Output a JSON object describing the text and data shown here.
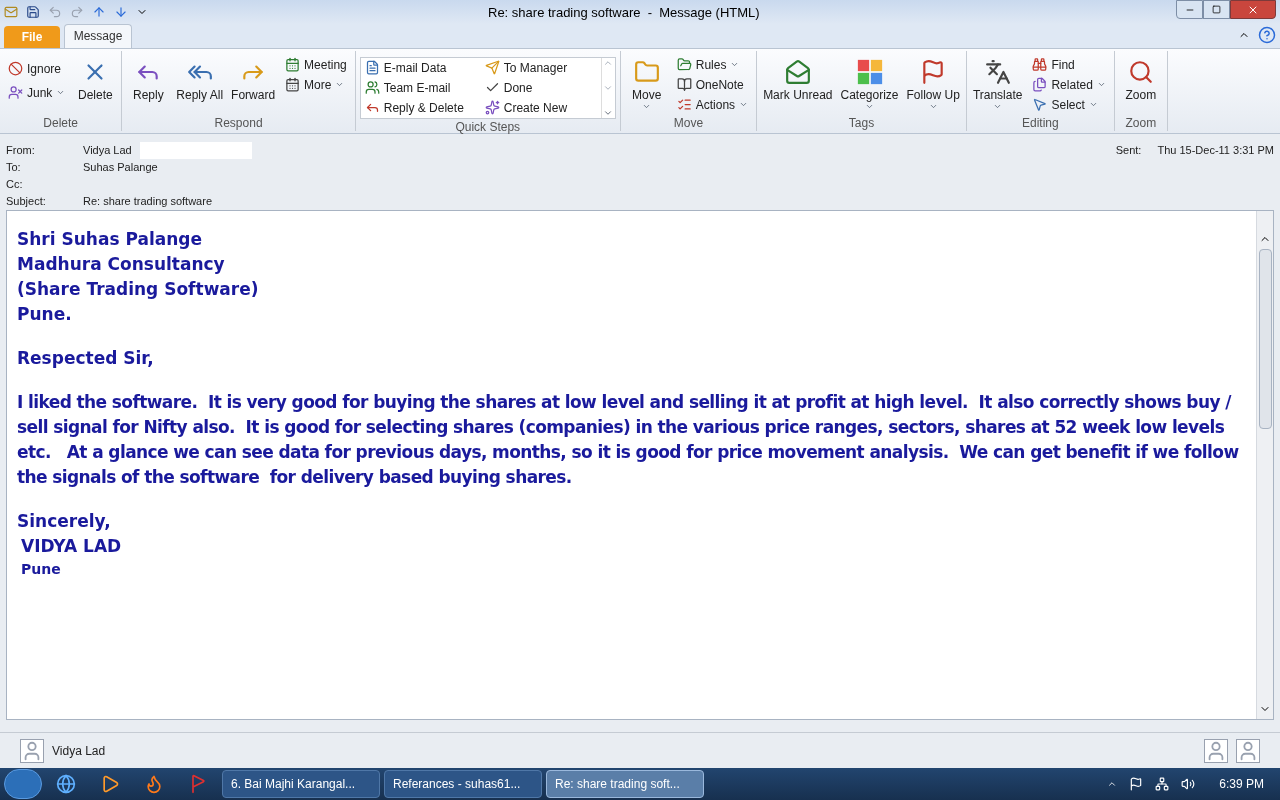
{
  "window": {
    "title": "Re: share trading software  -  Message (HTML)"
  },
  "ribbon": {
    "tabs": [
      {
        "label": "File",
        "kind": "file",
        "selected": false
      },
      {
        "label": "Message",
        "kind": "tab",
        "selected": true
      }
    ],
    "groups": [
      {
        "label": "Delete",
        "buttons": [
          {
            "label": "Ignore",
            "kind": "small",
            "dropdown": false
          },
          {
            "label": "Junk",
            "kind": "small",
            "dropdown": true
          },
          {
            "label": "Delete",
            "kind": "large",
            "dropdown": false
          }
        ]
      },
      {
        "label": "Respond",
        "buttons": [
          {
            "label": "Reply",
            "kind": "large",
            "dropdown": false
          },
          {
            "label": "Reply All",
            "kind": "large",
            "dropdown": false
          },
          {
            "label": "Forward",
            "kind": "large",
            "dropdown": false
          },
          {
            "label": "Meeting",
            "kind": "small",
            "dropdown": false
          },
          {
            "label": "More",
            "kind": "small",
            "dropdown": true
          }
        ]
      },
      {
        "label": "Quick Steps",
        "buttons": [
          {
            "label": "E-mail Data",
            "kind": "quick",
            "dropdown": false
          },
          {
            "label": "To Manager",
            "kind": "quick",
            "dropdown": false
          },
          {
            "label": "Team E-mail",
            "kind": "quick",
            "dropdown": false
          },
          {
            "label": "Done",
            "kind": "quick",
            "dropdown": false
          },
          {
            "label": "Reply & Delete",
            "kind": "quick",
            "dropdown": false
          },
          {
            "label": "Create New",
            "kind": "quick",
            "dropdown": false
          }
        ]
      },
      {
        "label": "Move",
        "buttons": [
          {
            "label": "Move",
            "kind": "large",
            "dropdown": true
          },
          {
            "label": "Rules",
            "kind": "small",
            "dropdown": true
          },
          {
            "label": "OneNote",
            "kind": "small",
            "dropdown": false
          },
          {
            "label": "Actions",
            "kind": "small",
            "dropdown": true
          }
        ]
      },
      {
        "label": "Tags",
        "buttons": [
          {
            "label": "Mark Unread",
            "kind": "large",
            "dropdown": false
          },
          {
            "label": "Categorize",
            "kind": "large",
            "dropdown": true
          },
          {
            "label": "Follow Up",
            "kind": "large",
            "dropdown": true
          }
        ]
      },
      {
        "label": "Editing",
        "buttons": [
          {
            "label": "Translate",
            "kind": "large",
            "dropdown": true
          },
          {
            "label": "Find",
            "kind": "small",
            "dropdown": false
          },
          {
            "label": "Related",
            "kind": "small",
            "dropdown": true
          },
          {
            "label": "Select",
            "kind": "small",
            "dropdown": true
          }
        ]
      },
      {
        "label": "Zoom",
        "buttons": [
          {
            "label": "Zoom",
            "kind": "large",
            "dropdown": false
          }
        ]
      }
    ]
  },
  "header": {
    "fields": [
      {
        "label": "From:",
        "value": "Vidya Lad"
      },
      {
        "label": "To:",
        "value": "Suhas Palange"
      },
      {
        "label": "Cc:"
      },
      {
        "label": "Subject:",
        "value": "Re: share trading software"
      }
    ],
    "sent_label": "Sent:",
    "sent_value": "Thu 15-Dec-11 3:31 PM"
  },
  "body": {
    "address_lines": [
      "Shri Suhas Palange",
      "Madhura Consultancy",
      "(Share Trading Software)",
      "Pune."
    ],
    "greeting": "Respected Sir,",
    "paragraph": "I liked the software.  It is very good for buying the shares at low level and selling it at profit at high level.  It also correctly shows buy / sell signal for Nifty also.  It is good for selecting shares (companies) in the various price ranges, sectors, shares at 52 week low levels etc.   At a glance we can see data for previous days, months, so it is good for price movement analysis.  We can get benefit if we follow the signals of the software  for delivery based buying shares.",
    "closing": "Sincerely,",
    "signature_name": "VIDYA LAD",
    "signature_city": "Pune"
  },
  "people_pane": {
    "name": "Vidya Lad"
  },
  "taskbar": {
    "items": [
      {
        "label": "6. Bai Majhi Karangal...",
        "selected": false
      },
      {
        "label": "Referances - suhas61...",
        "selected": false
      },
      {
        "label": "Re: share trading soft...",
        "selected": true
      }
    ],
    "clock": "6:39 PM"
  }
}
